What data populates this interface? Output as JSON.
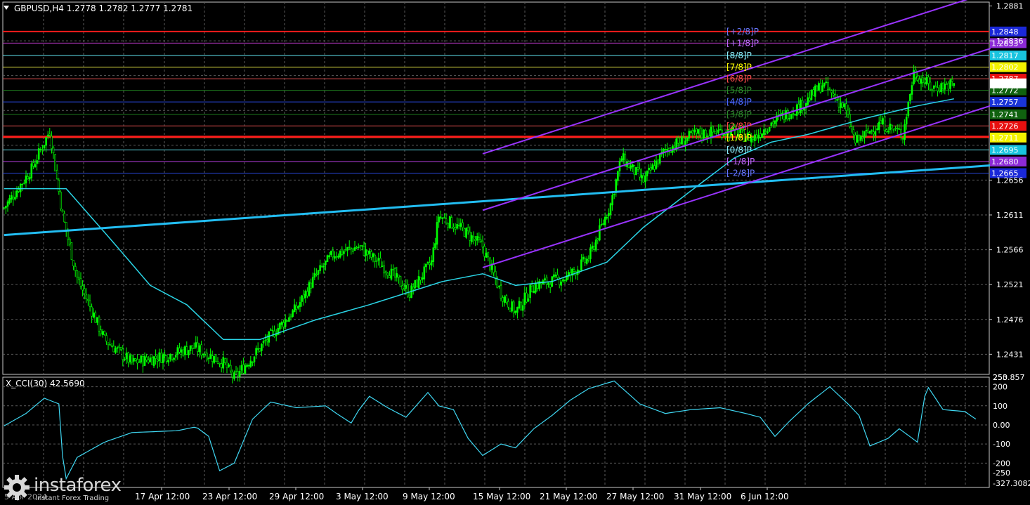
{
  "header": {
    "symbol": "GBPUSD,H4",
    "ohlc": "1.2778 1.2782 1.2777 1.2781",
    "menu_arrow": "triangle-down-icon"
  },
  "colors": {
    "background": "#000000",
    "grid": "#5a5a5a",
    "candle": "#00ff00",
    "ma": "#2ad5e6",
    "trendline": "#22bdf2",
    "channel": "#9933ff",
    "red_level": "#ff1b1b",
    "cci": "#3fd7f2",
    "axis_text": "#ffffff"
  },
  "chart_data": {
    "type": "candlestick",
    "instrument": "GBPUSD",
    "timeframe": "H4",
    "last_ohlc": {
      "open": 1.2778,
      "high": 1.2782,
      "low": 1.2777,
      "close": 1.2781
    },
    "y_range": [
      1.2405,
      1.2886
    ],
    "price_ticks": [
      "1.2881",
      "1.2836",
      "1.2656",
      "1.2611",
      "1.2566",
      "1.2521",
      "1.2476",
      "1.2431"
    ],
    "x_tick_labels": [
      "17 Apr 12:00",
      "23 Apr 12:00",
      "29 Apr 12:00",
      "3 May 12:00",
      "9 May 12:00",
      "15 May 12:00",
      "21 May 12:00",
      "27 May 12:00",
      "31 May 12:00",
      "6 Jun 12:00"
    ],
    "x_cut_left_label": "5 Apr 2024",
    "price_anchors": [
      [
        0,
        1.262
      ],
      [
        15,
        1.267
      ],
      [
        25,
        1.272
      ],
      [
        32,
        1.261
      ],
      [
        40,
        1.253
      ],
      [
        55,
        1.245
      ],
      [
        70,
        1.242
      ],
      [
        90,
        1.243
      ],
      [
        104,
        1.244
      ],
      [
        120,
        1.242
      ],
      [
        126,
        1.24
      ],
      [
        144,
        1.245
      ],
      [
        160,
        1.249
      ],
      [
        170,
        1.253
      ],
      [
        180,
        1.256
      ],
      [
        194,
        1.257
      ],
      [
        210,
        1.254
      ],
      [
        222,
        1.251
      ],
      [
        234,
        1.255
      ],
      [
        238,
        1.261
      ],
      [
        252,
        1.259
      ],
      [
        262,
        1.257
      ],
      [
        272,
        1.251
      ],
      [
        280,
        1.2485
      ],
      [
        290,
        1.252
      ],
      [
        308,
        1.253
      ],
      [
        320,
        1.2555
      ],
      [
        332,
        1.2625
      ],
      [
        338,
        1.2685
      ],
      [
        350,
        1.2655
      ],
      [
        362,
        1.2695
      ],
      [
        378,
        1.2715
      ],
      [
        395,
        1.272
      ],
      [
        410,
        1.271
      ],
      [
        420,
        1.273
      ],
      [
        438,
        1.2755
      ],
      [
        448,
        1.278
      ],
      [
        460,
        1.275
      ],
      [
        466,
        1.2705
      ],
      [
        480,
        1.273
      ],
      [
        492,
        1.2715
      ],
      [
        498,
        1.2795
      ],
      [
        508,
        1.2775
      ],
      [
        520,
        1.2781
      ]
    ],
    "ma_anchors": [
      [
        0,
        1.2645
      ],
      [
        34,
        1.2645
      ],
      [
        60,
        1.2575
      ],
      [
        80,
        1.252
      ],
      [
        100,
        1.2495
      ],
      [
        120,
        1.245
      ],
      [
        140,
        1.245
      ],
      [
        170,
        1.2475
      ],
      [
        200,
        1.2495
      ],
      [
        240,
        1.2525
      ],
      [
        262,
        1.2535
      ],
      [
        280,
        1.252
      ],
      [
        300,
        1.2525
      ],
      [
        330,
        1.255
      ],
      [
        350,
        1.2595
      ],
      [
        372,
        1.2635
      ],
      [
        400,
        1.2685
      ],
      [
        420,
        1.2705
      ],
      [
        440,
        1.2715
      ],
      [
        470,
        1.2735
      ],
      [
        500,
        1.2752
      ],
      [
        520,
        1.2761
      ]
    ],
    "murrey_levels": [
      {
        "label": "[+2/8]P",
        "value": "1.2848",
        "color": "#1a28d8",
        "text": "#6a78ff",
        "stroke": "#ff1b1b",
        "sw": 2
      },
      {
        "label": "[+1/8]P",
        "value": "1.2833",
        "color": "#8c2ad6",
        "text": "#c06bff",
        "stroke": "#c23cd0",
        "sw": 1
      },
      {
        "label": "[8/8]P",
        "value": "1.2817",
        "color": "#19c4df",
        "text": "#8ff1ff",
        "stroke": "#5fe4ef",
        "sw": 1
      },
      {
        "label": "[7/8]P",
        "value": "1.2802",
        "color": "#f3f300",
        "text": "#ffff00",
        "stroke": "#e7e745",
        "sw": 1
      },
      {
        "label": "[6/8]P",
        "value": "1.2787",
        "color": "#e81010",
        "text": "#ff4a4a",
        "stroke": "#d24a4a",
        "sw": 1
      },
      {
        "label": "[5/8]P",
        "value": "1.2772",
        "color": "#10620f",
        "text": "#2e8a2e",
        "stroke": "#1e7a1e",
        "sw": 1
      },
      {
        "label": "[4/8]P",
        "value": "1.2757",
        "color": "#1a34d8",
        "text": "#4e6aff",
        "stroke": "#2846d8",
        "sw": 1
      },
      {
        "label": "[3/8]P",
        "value": "1.2741",
        "color": "#10620f",
        "text": "#2e8a2e",
        "stroke": "#1e7a1e",
        "sw": 1
      },
      {
        "label": "[2/8]P",
        "value": "1.2726",
        "color": "#e81010",
        "text": "#ff4a4a",
        "stroke": "#d24a4a",
        "sw": 1
      },
      {
        "label": "[1/8]P",
        "value": "1.2711",
        "color": "#f3f300",
        "text": "#ffff00",
        "stroke": "#e7e745",
        "sw": 1
      },
      {
        "label": "[0/8]P",
        "value": "1.2695",
        "color": "#19c4df",
        "text": "#8ff1ff",
        "stroke": "#5fe4ef",
        "sw": 1
      },
      {
        "label": "[-1/8]P",
        "value": "1.2680",
        "color": "#8c2ad6",
        "text": "#c06bff",
        "stroke": "#b73ee0",
        "sw": 1
      },
      {
        "label": "[-2/8]P",
        "value": "1.2665",
        "color": "#1a28d8",
        "text": "#6a78ff",
        "stroke": "#2846d8",
        "sw": 1
      }
    ],
    "red_horizontal": 1.2712,
    "trendline": {
      "from": [
        0,
        1.2585
      ],
      "to": [
        540,
        1.2675
      ]
    },
    "channel": {
      "slope_per_bar": 7.52e-05,
      "lower_at_0": 1.2346,
      "upper_at_0": 1.2493,
      "mid_at_0": 1.242,
      "start_bar": 262,
      "end_bar": 540
    },
    "cci": {
      "name": "X_CCI(30) 42.5690",
      "y_range": [
        -327.3082,
        250
      ],
      "ticks": [
        "250",
        "200",
        "100",
        "0.00",
        "-100",
        "-200",
        "-250"
      ],
      "max_label": "253.857",
      "min_label": "-327.3082",
      "anchors": [
        [
          0,
          -5
        ],
        [
          12,
          60
        ],
        [
          22,
          140
        ],
        [
          30,
          110
        ],
        [
          33,
          -300
        ],
        [
          40,
          -170
        ],
        [
          55,
          -90
        ],
        [
          70,
          -40
        ],
        [
          95,
          -30
        ],
        [
          105,
          -10
        ],
        [
          112,
          -60
        ],
        [
          118,
          -240
        ],
        [
          126,
          -200
        ],
        [
          136,
          30
        ],
        [
          146,
          120
        ],
        [
          160,
          90
        ],
        [
          176,
          100
        ],
        [
          182,
          60
        ],
        [
          190,
          10
        ],
        [
          194,
          75
        ],
        [
          200,
          150
        ],
        [
          210,
          90
        ],
        [
          220,
          40
        ],
        [
          232,
          170
        ],
        [
          238,
          100
        ],
        [
          246,
          80
        ],
        [
          254,
          -70
        ],
        [
          262,
          -160
        ],
        [
          272,
          -100
        ],
        [
          280,
          -120
        ],
        [
          290,
          -20
        ],
        [
          300,
          50
        ],
        [
          310,
          130
        ],
        [
          320,
          190
        ],
        [
          334,
          230
        ],
        [
          348,
          110
        ],
        [
          362,
          60
        ],
        [
          376,
          80
        ],
        [
          392,
          90
        ],
        [
          406,
          60
        ],
        [
          414,
          40
        ],
        [
          422,
          -60
        ],
        [
          430,
          20
        ],
        [
          440,
          110
        ],
        [
          452,
          200
        ],
        [
          462,
          110
        ],
        [
          468,
          50
        ],
        [
          474,
          -110
        ],
        [
          484,
          -70
        ],
        [
          490,
          -20
        ],
        [
          500,
          -90
        ],
        [
          505,
          210
        ],
        [
          514,
          80
        ],
        [
          526,
          70
        ],
        [
          532,
          30
        ]
      ]
    }
  },
  "watermark": {
    "logo": "gear-logo-icon",
    "name": "instaforex",
    "tagline": "Instant Forex Trading"
  }
}
